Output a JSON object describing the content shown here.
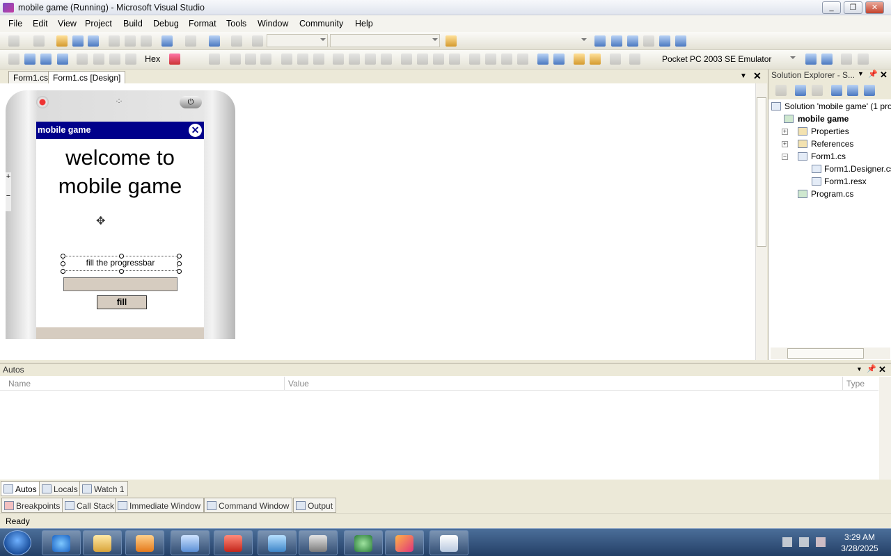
{
  "window": {
    "title": "mobile game (Running) - Microsoft Visual Studio"
  },
  "menu": [
    "File",
    "Edit",
    "View",
    "Project",
    "Build",
    "Debug",
    "Format",
    "Tools",
    "Window",
    "Community",
    "Help"
  ],
  "toolbar2": {
    "hex_label": "Hex",
    "target_device": "Pocket PC 2003 SE Emulator"
  },
  "tabs": [
    {
      "label": "Form1.cs"
    },
    {
      "label": "Form1.cs [Design]"
    }
  ],
  "form": {
    "title": "mobile game",
    "welcome": "welcome to mobile game",
    "label": "fill the progressbar",
    "progress": 0,
    "button": "fill"
  },
  "solution_explorer": {
    "header": "Solution Explorer - S...",
    "items": [
      {
        "label": "Solution 'mobile game' (1 pro"
      },
      {
        "label": "mobile game"
      },
      {
        "label": "Properties"
      },
      {
        "label": "References"
      },
      {
        "label": "Form1.cs"
      },
      {
        "label": "Form1.Designer.cs"
      },
      {
        "label": "Form1.resx"
      },
      {
        "label": "Program.cs"
      }
    ]
  },
  "autos": {
    "header": "Autos",
    "columns": [
      "Name",
      "Value",
      "Type"
    ]
  },
  "debug_tabs": [
    "Autos",
    "Locals",
    "Watch 1"
  ],
  "tool_tabs": [
    "Breakpoints",
    "Call Stack",
    "Immediate Window",
    "Command Window",
    "Output"
  ],
  "status": "Ready",
  "clock": {
    "time": "3:29 AM",
    "date": "3/28/2025"
  }
}
